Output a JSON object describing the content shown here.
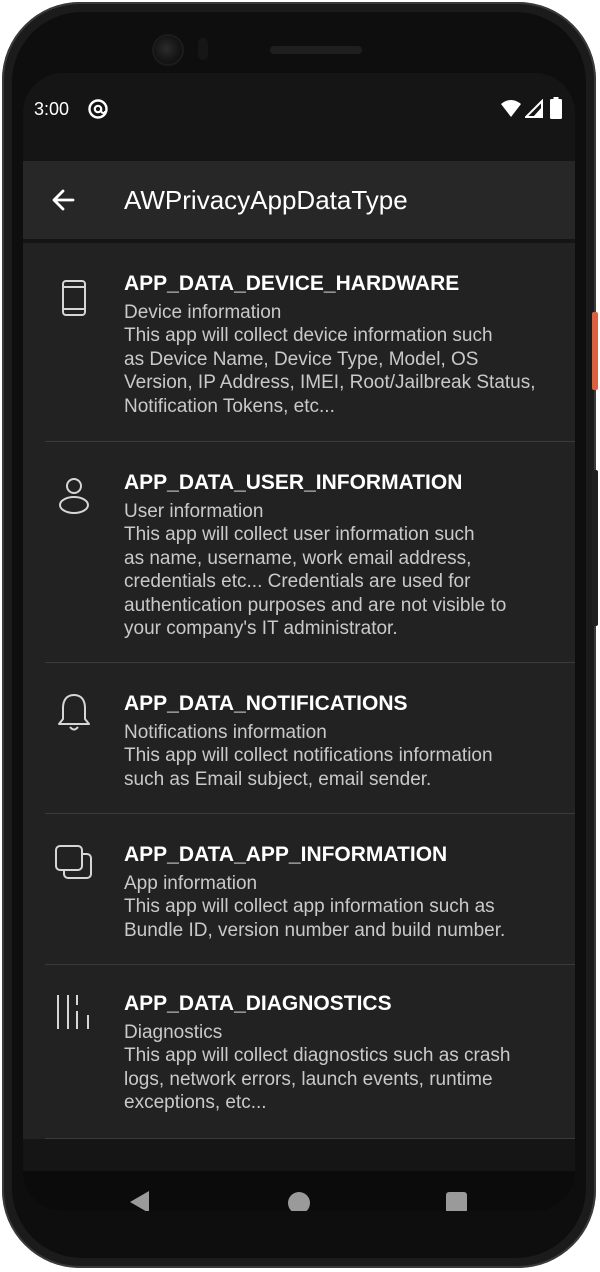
{
  "status_bar": {
    "time": "3:00",
    "icons": [
      "at-sign-icon",
      "wifi-icon",
      "signal-icon",
      "battery-icon"
    ]
  },
  "toolbar": {
    "back_icon": "arrow-left-icon",
    "title": "AWPrivacyAppDataType"
  },
  "items": [
    {
      "icon": "phone-device-icon",
      "title": "APP_DATA_DEVICE_HARDWARE",
      "subtitle": "Device information",
      "description_lines": [
        "This app will collect device information such",
        "as Device Name, Device Type, Model, OS",
        "Version, IP Address, IMEI, Root/Jailbreak Status,",
        "Notification Tokens, etc..."
      ]
    },
    {
      "icon": "user-icon",
      "title": "APP_DATA_USER_INFORMATION",
      "subtitle": "User information",
      "description_lines": [
        "This app will collect user information such",
        "as name, username, work email address,",
        "credentials etc... Credentials are used for",
        "authentication purposes and are not visible to",
        "your company's IT administrator."
      ]
    },
    {
      "icon": "bell-icon",
      "title": "APP_DATA_NOTIFICATIONS",
      "subtitle": "Notifications information",
      "description_lines": [
        "This app will collect notifications information",
        "such as Email subject, email sender."
      ]
    },
    {
      "icon": "copy-squares-icon",
      "title": "APP_DATA_APP_INFORMATION",
      "subtitle": "App information",
      "description_lines": [
        "This app will collect app information such as",
        "Bundle ID, version number and build number."
      ]
    },
    {
      "icon": "diagnostics-bars-icon",
      "title": "APP_DATA_DIAGNOSTICS",
      "subtitle": "Diagnostics",
      "description_lines": [
        "This app will collect diagnostics such as crash",
        "logs, network errors, launch events, runtime",
        "exceptions, etc..."
      ]
    }
  ],
  "nav_bar": {
    "icons": [
      "nav-back-icon",
      "nav-home-icon",
      "nav-recents-icon"
    ]
  },
  "colors": {
    "screen_background": "#151515",
    "toolbar_background": "#272727",
    "list_background": "#222222",
    "title_text": "#ffffff",
    "body_text": "#c9c9c9",
    "power_button": "#d8623f"
  }
}
